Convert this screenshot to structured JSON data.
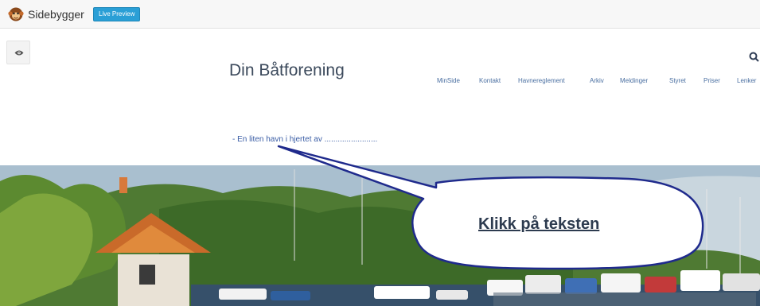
{
  "builder": {
    "name": "Sidebygger",
    "live_preview_label": "Live Preview",
    "logo_icon": "monkey-face-icon"
  },
  "panel": {
    "toggle_icon": "eye-icon"
  },
  "site": {
    "title": "Din Båtforening",
    "tagline": "- En liten havn i hjertet av ........................",
    "search_icon": "search-icon",
    "nav": [
      {
        "label": "MinSide"
      },
      {
        "label": "Kontakt"
      },
      {
        "label": "Havnereglement"
      },
      {
        "label": "Arkiv"
      },
      {
        "label": "Meldinger"
      },
      {
        "label": "Styret"
      },
      {
        "label": "Priser"
      },
      {
        "label": "Lenker"
      }
    ]
  },
  "callout": {
    "text": "Klikk på teksten",
    "fill": "#ffffff",
    "stroke": "#1f2a8c"
  },
  "colors": {
    "accent": "#2a9fd6",
    "title": "#3c4a5c",
    "nav": "#4a6fa1",
    "tagline": "#3a5da5"
  }
}
